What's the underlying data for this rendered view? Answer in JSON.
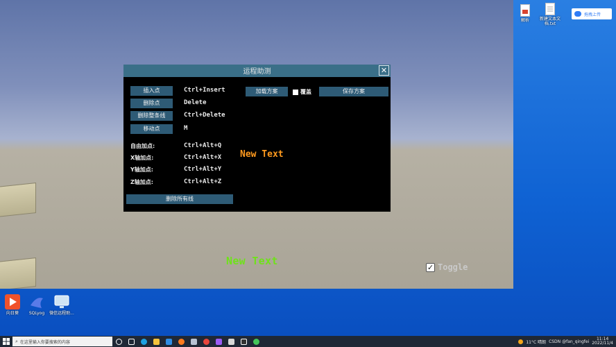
{
  "panel": {
    "title": "运程助测",
    "close_label": "✕",
    "buttons": {
      "insert_point": "插入点",
      "delete_point": "删除点",
      "delete_all_lines": "删除整条线",
      "move_point": "移动点",
      "load_plan": "加载方案",
      "save_plan": "保存方案",
      "delete_all": "删除所有线"
    },
    "shortcuts": {
      "insert_point": "Ctrl+Insert",
      "delete_point": "Delete",
      "delete_all_lines": "Ctrl+Delete",
      "move_point": "M",
      "free_point": "Ctrl+Alt+Q",
      "x_axis": "Ctrl+Alt+X",
      "y_axis": "Ctrl+Alt+Y",
      "z_axis": "Ctrl+Alt+Z"
    },
    "labels": {
      "free_point": "自由加点:",
      "x_axis": "X轴加点:",
      "y_axis": "Y轴加点:",
      "z_axis": "Z轴加点:"
    },
    "cover_label": "覆盖",
    "new_text": "New Text"
  },
  "game": {
    "bottom_text": "New Text",
    "toggle_label": "Toggle",
    "toggle_check": "✓"
  },
  "desktop": {
    "icons_right": [
      {
        "label": "解析",
        "icon": "document-icon"
      },
      {
        "label": "新建文本文\n档.txt",
        "icon": "text-file-icon"
      }
    ],
    "baidu_label": "拖拽上传",
    "icons_left": [
      {
        "label": "向日葵",
        "icon": "sunlogin-icon",
        "color": "#f0522b"
      },
      {
        "label": "SQLyog",
        "icon": "sqlyog-icon",
        "color": "#5a7be8"
      },
      {
        "label": "微信远程助...",
        "icon": "remote-assist-icon",
        "color": "#cfe4f4"
      }
    ]
  },
  "taskbar": {
    "search_placeholder": "在这里输入你要搜索的内容",
    "apps": [
      {
        "icon": "search-circle-icon",
        "color": "#ffffff"
      },
      {
        "icon": "task-view-icon",
        "color": "#ffffff"
      },
      {
        "icon": "edge-icon",
        "color": "#1fa0e0"
      },
      {
        "icon": "explorer-icon",
        "color": "#f3c23c"
      },
      {
        "icon": "store-icon",
        "color": "#2f8de4"
      },
      {
        "icon": "firefox-icon",
        "color": "#ff7b1e"
      },
      {
        "icon": "monitor-icon",
        "color": "#b8c3d4"
      },
      {
        "icon": "git-icon",
        "color": "#e8453c"
      },
      {
        "icon": "visual-studio-icon",
        "color": "#9b5cf5"
      },
      {
        "icon": "unity-hub-icon",
        "color": "#d8d8d8"
      },
      {
        "icon": "unity-icon",
        "color": "#ffffff"
      },
      {
        "icon": "wechat-icon",
        "color": "#43c55a"
      }
    ],
    "weather": "11°C 晴朗",
    "tray_text": "CSDN @fan_qingfei",
    "time": "11:14",
    "date": "2022/11/4"
  }
}
